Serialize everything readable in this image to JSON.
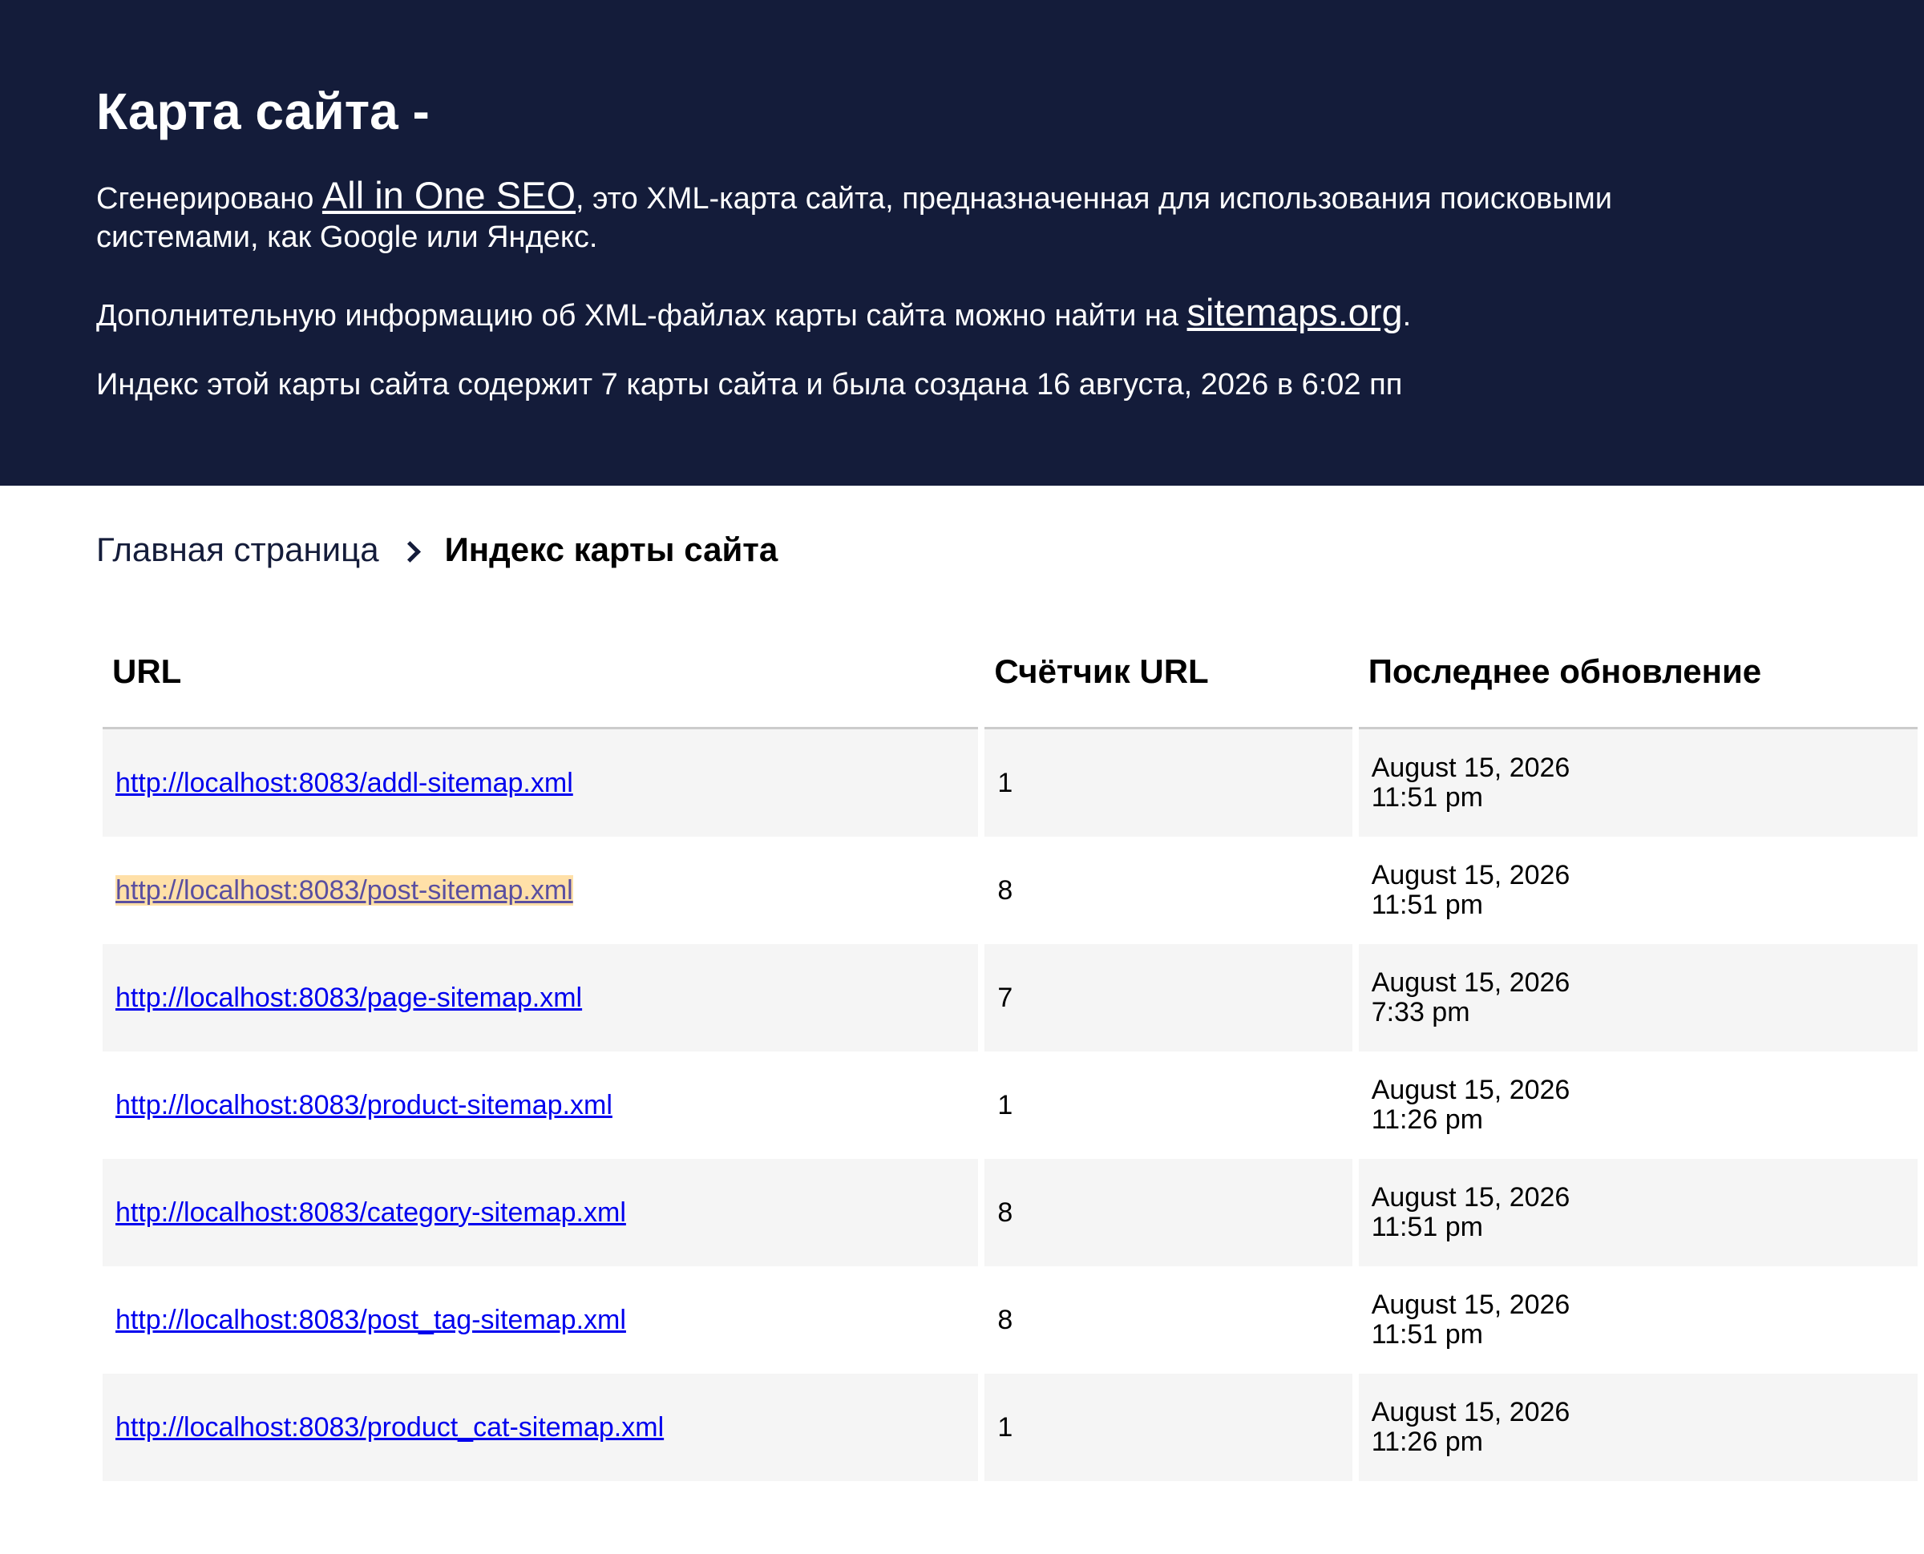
{
  "header": {
    "title": "Карта сайта -",
    "generated_prefix": "Сгенерировано ",
    "generated_link": "All in One SEO",
    "generated_suffix": ", это XML-карта сайта, предназначенная для использования поисковыми системами, как Google или Яндекс.",
    "more_prefix": "Дополнительную информацию об XML-файлах карты сайта можно найти на ",
    "more_link": "sitemaps.org",
    "more_suffix": ".",
    "index_info": "Индекс этой карты сайта содержит 7 карты сайта и была создана 16 августа, 2026 в 6:02 пп"
  },
  "breadcrumb": {
    "home": "Главная страница",
    "current": "Индекс карты сайта"
  },
  "table": {
    "headers": {
      "url": "URL",
      "count": "Счётчик URL",
      "updated": "Последнее обновление"
    },
    "rows": [
      {
        "url": "http://localhost:8083/addl-sitemap.xml",
        "count": "1",
        "date": "August 15, 2026",
        "time": "11:51 pm"
      },
      {
        "url": "http://localhost:8083/post-sitemap.xml",
        "count": "8",
        "date": "August 15, 2026",
        "time": "11:51 pm"
      },
      {
        "url": "http://localhost:8083/page-sitemap.xml",
        "count": "7",
        "date": "August 15, 2026",
        "time": "7:33 pm"
      },
      {
        "url": "http://localhost:8083/product-sitemap.xml",
        "count": "1",
        "date": "August 15, 2026",
        "time": "11:26 pm"
      },
      {
        "url": "http://localhost:8083/category-sitemap.xml",
        "count": "8",
        "date": "August 15, 2026",
        "time": "11:51 pm"
      },
      {
        "url": "http://localhost:8083/post_tag-sitemap.xml",
        "count": "8",
        "date": "August 15, 2026",
        "time": "11:51 pm"
      },
      {
        "url": "http://localhost:8083/product_cat-sitemap.xml",
        "count": "1",
        "date": "August 15, 2026",
        "time": "11:26 pm"
      }
    ]
  },
  "colors": {
    "header_bg": "#141c3a",
    "link": "#0000ee",
    "row_alt": "#f5f5f5",
    "highlight": "#ffe0a8"
  }
}
